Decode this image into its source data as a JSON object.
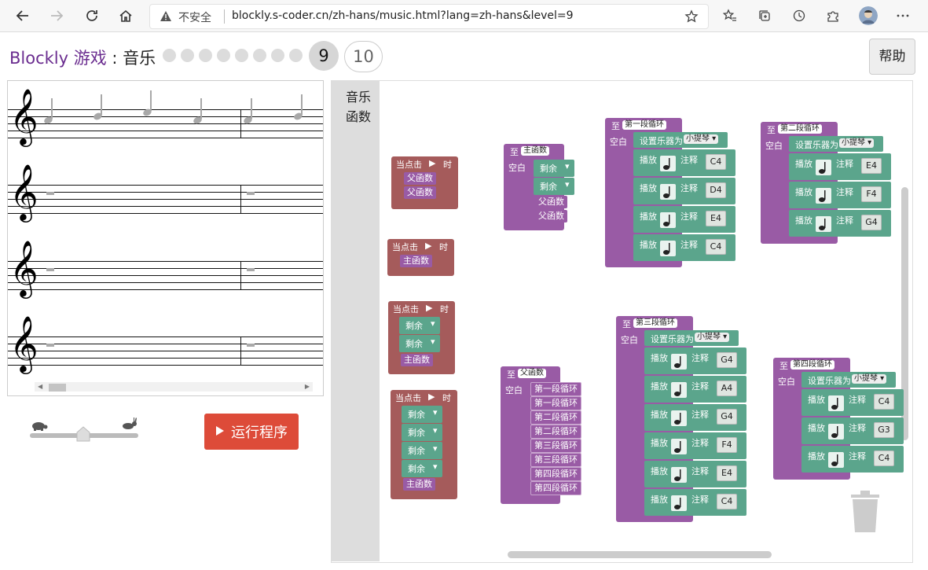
{
  "browser": {
    "insecure_label": "不安全",
    "url": "blockly.s-coder.cn/zh-hans/music.html?lang=zh-hans&level=9"
  },
  "header": {
    "title": "Blockly 游戏",
    "subtitle": " : 音乐",
    "current_level": "9",
    "next_level": "10",
    "help_label": "帮助"
  },
  "controls": {
    "run_label": "运行程序",
    "speed": 0.5
  },
  "toolbox": {
    "categories": [
      "音乐",
      "函数"
    ]
  },
  "blocks": {
    "when_clicked": "当点击",
    "time": "时",
    "to": "至",
    "blank": "空白",
    "set_instrument": "设置乐器为",
    "violin": "小提琴",
    "play": "播放",
    "note": "注释",
    "remaining": "剩余",
    "main_func": "主函数",
    "father_func": "父函数",
    "loop1": "第一段循环",
    "loop2": "第二段循环",
    "loop3": "第三段循环",
    "loop4": "第四段循环",
    "loop1_notes": [
      "C4",
      "D4",
      "E4",
      "C4"
    ],
    "loop2_notes": [
      "E4",
      "F4",
      "G4"
    ],
    "loop3_notes": [
      "G4",
      "A4",
      "G4",
      "F4",
      "E4",
      "C4"
    ],
    "loop4_notes": [
      "C4",
      "G3",
      "C4"
    ]
  }
}
